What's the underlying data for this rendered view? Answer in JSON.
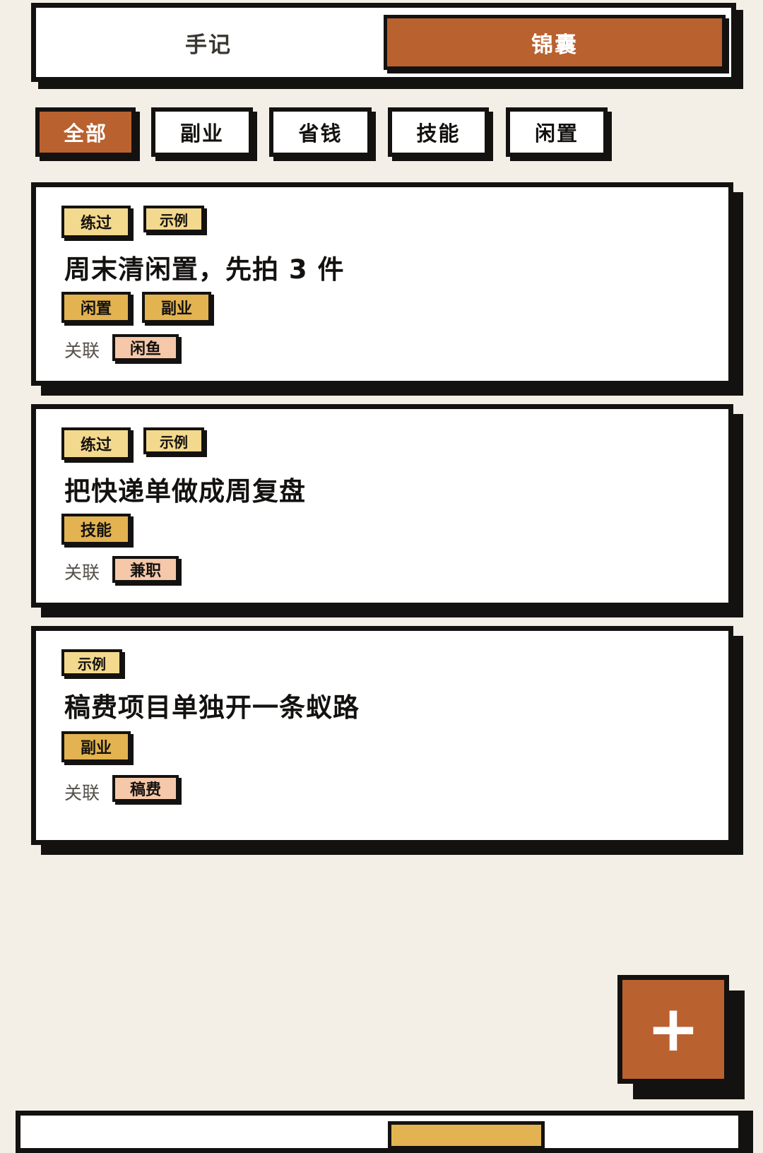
{
  "tabs": [
    {
      "label": "手记",
      "active": false
    },
    {
      "label": "锦囊",
      "active": true
    }
  ],
  "filters": [
    {
      "label": "全部",
      "active": true
    },
    {
      "label": "副业",
      "active": false
    },
    {
      "label": "省钱",
      "active": false
    },
    {
      "label": "技能",
      "active": false
    },
    {
      "label": "闲置",
      "active": false
    }
  ],
  "cards": [
    {
      "status_tags": [
        "练过",
        "示例"
      ],
      "title": "周末清闲置，先拍 3 件",
      "category_tags": [
        "闲置",
        "副业"
      ],
      "related_label": "关联",
      "related": [
        "闲鱼"
      ]
    },
    {
      "status_tags": [
        "练过",
        "示例"
      ],
      "title": "把快递单做成周复盘",
      "category_tags": [
        "技能"
      ],
      "related_label": "关联",
      "related": [
        "兼职"
      ]
    },
    {
      "status_tags": [
        "示例"
      ],
      "title": "稿费项目单独开一条蚁路",
      "category_tags": [
        "副业"
      ],
      "related_label": "关联",
      "related": [
        "稿费"
      ]
    }
  ],
  "fab": {
    "icon": "plus-icon",
    "label": "+"
  },
  "colors": {
    "background": "#f4efe6",
    "accent": "#b9612f",
    "ink": "#141210",
    "status_tag": "#f3d98d",
    "category_tag": "#e2b350",
    "related_tag": "#f5c8a9"
  }
}
